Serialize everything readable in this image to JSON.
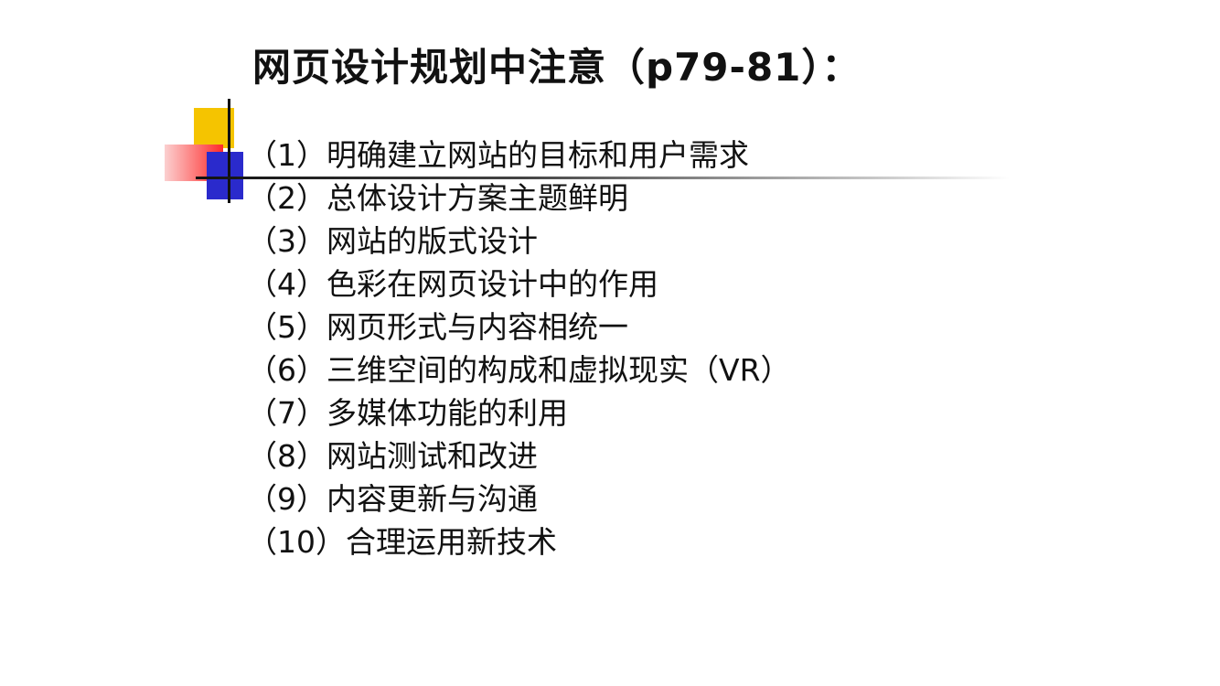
{
  "slide": {
    "title": "网页设计规划中注意（p79-81）：",
    "items": [
      "（1）明确建立网站的目标和用户需求",
      "（2）总体设计方案主题鲜明",
      "（3）网站的版式设计",
      "（4）色彩在网页设计中的作用",
      "（5）网页形式与内容相统一",
      "（6）三维空间的构成和虚拟现实（VR）",
      "（7）多媒体功能的利用",
      "（8）网站测试和改进",
      "（9）内容更新与沟通",
      "（10）合理运用新技术"
    ]
  },
  "colors": {
    "deco_yellow": "#f5c400",
    "deco_red": "#ff2a2a",
    "deco_blue": "#2a2acc",
    "text": "#111111",
    "background": "#ffffff"
  }
}
